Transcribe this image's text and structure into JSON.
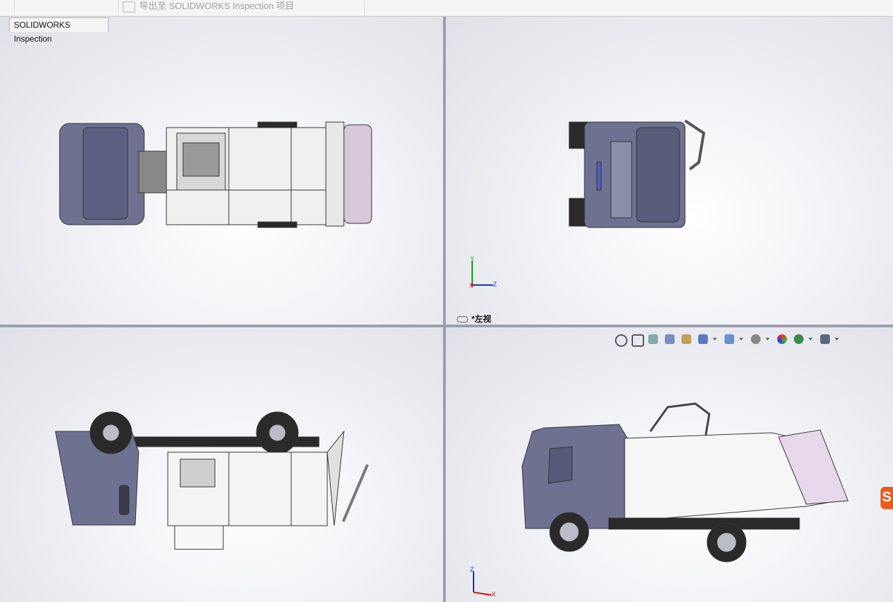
{
  "commandbar": {
    "export_label": "导出至 SOLIDWORKS Inspection 项目",
    "export_icon": "export-inspection-icon"
  },
  "tab": {
    "label": "SOLIDWORKS Inspection"
  },
  "viewports": {
    "top_right": {
      "view_label": "*左视",
      "triad": {
        "x": "X",
        "y": "Y",
        "z": "Z"
      }
    },
    "bottom_right": {
      "triad": {
        "x": "X",
        "z": "Z"
      }
    }
  },
  "heads_up_toolbar": {
    "icons": [
      "zoom-to-fit-icon",
      "zoom-to-area-icon",
      "previous-view-icon",
      "section-view-icon",
      "dynamic-annotation-icon",
      "view-orientation-icon",
      "display-style-icon",
      "hide-show-icon",
      "edit-appearance-icon",
      "apply-scene-icon",
      "view-settings-icon"
    ]
  },
  "colors": {
    "truck_cab": "#6e7290",
    "truck_body": "#f4f4f4",
    "tire": "#2a2a2a",
    "rear": "#d8c8dc",
    "triad_x": "#d01010",
    "triad_y": "#10a010",
    "triad_z": "#1030d0"
  }
}
